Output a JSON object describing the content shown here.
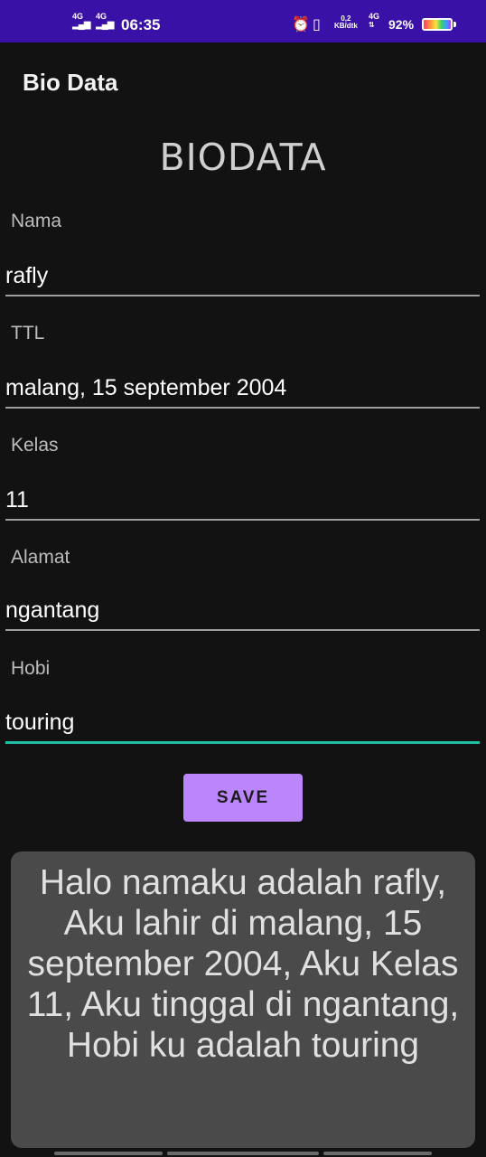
{
  "status_bar": {
    "sim1": "4G",
    "sim2": "4G",
    "time": "06:35",
    "speed_value": "0,2",
    "speed_unit": "KB/dtk",
    "network": "4G",
    "battery_percent": "92%",
    "battery_level": 0.92
  },
  "app_bar": {
    "title": "Bio Data"
  },
  "form": {
    "heading": "BIODATA",
    "fields": [
      {
        "label": "Nama",
        "value": "rafly"
      },
      {
        "label": "TTL",
        "value": "malang, 15 september 2004"
      },
      {
        "label": "Kelas",
        "value": "11"
      },
      {
        "label": "Alamat",
        "value": "ngantang"
      },
      {
        "label": "Hobi",
        "value": "touring"
      }
    ],
    "save_label": "SAVE"
  },
  "result": {
    "text": "Halo namaku adalah rafly, Aku lahir di malang, 15 september 2004, Aku Kelas 11, Aku tinggal di ngantang, Hobi ku adalah touring"
  },
  "colors": {
    "status_bar": "#3a11a6",
    "background": "#121212",
    "button": "#bb86fc",
    "focus_underline": "#1fbfa6",
    "result_box": "#4a4a4a"
  }
}
